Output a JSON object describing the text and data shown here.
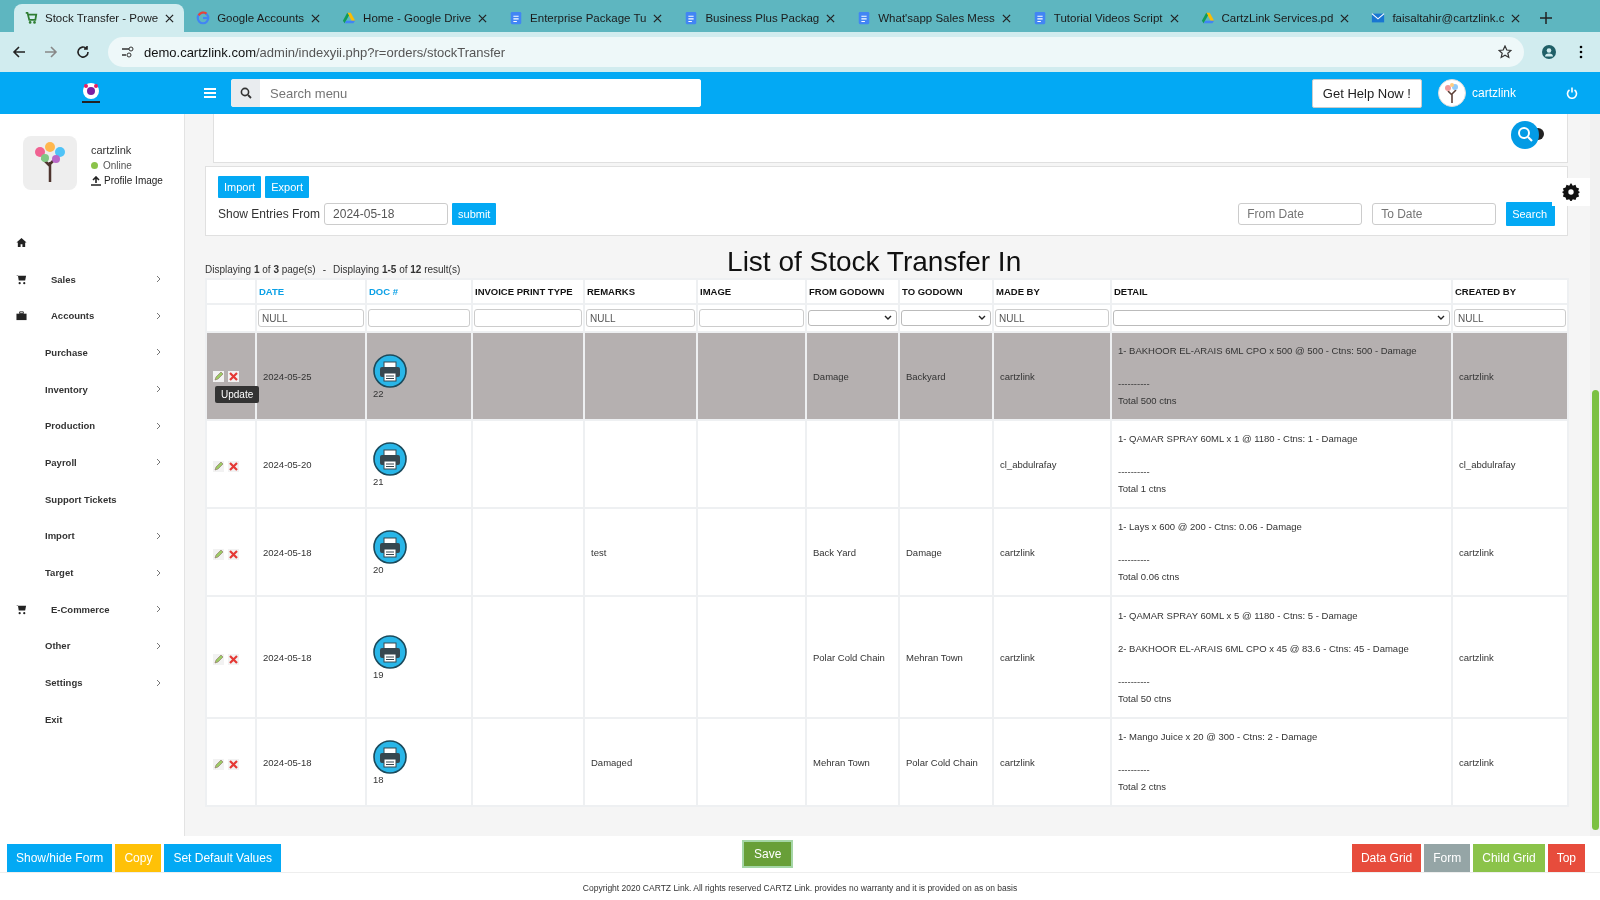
{
  "browser": {
    "tabs": [
      {
        "title": "Stock Transfer - Powe",
        "kind": "cart",
        "selected": true
      },
      {
        "title": "Google Accounts",
        "kind": "google",
        "selected": false
      },
      {
        "title": "Home - Google Drive",
        "kind": "drive",
        "selected": false
      },
      {
        "title": "Enterprise Package Tu",
        "kind": "doc",
        "selected": false
      },
      {
        "title": "Business Plus Packag",
        "kind": "doc",
        "selected": false
      },
      {
        "title": "What'sapp Sales Mess",
        "kind": "doc",
        "selected": false
      },
      {
        "title": "Tutorial Videos Script",
        "kind": "doc",
        "selected": false
      },
      {
        "title": "CartzLink Services.pd",
        "kind": "drive",
        "selected": false
      },
      {
        "title": "faisaltahir@cartzlink.c",
        "kind": "mail",
        "selected": false
      }
    ],
    "url_host": "demo.cartzlink.com",
    "url_path": "/admin/indexyii.php?r=orders/stockTransfer"
  },
  "header": {
    "search_placeholder": "Search menu",
    "help_button": "Get Help Now !",
    "user": "cartzlink"
  },
  "sidebar": {
    "user": {
      "name": "cartzlink",
      "status": "Online",
      "profile_link": "Profile Image"
    },
    "items": [
      {
        "kind": "home",
        "arrow": false
      },
      {
        "label": "Sales",
        "kind": "cart",
        "arrow": true
      },
      {
        "label": "Accounts",
        "kind": "briefcase",
        "arrow": true
      },
      {
        "label": "Purchase",
        "kind": "plain",
        "arrow": true
      },
      {
        "label": "Inventory",
        "kind": "plain",
        "arrow": true
      },
      {
        "label": "Production",
        "kind": "plain",
        "arrow": true
      },
      {
        "label": "Payroll",
        "kind": "plain",
        "arrow": true
      },
      {
        "label": "Support Tickets",
        "kind": "plain",
        "arrow": false
      },
      {
        "label": "Import",
        "kind": "plain",
        "arrow": true
      },
      {
        "label": "Target",
        "kind": "plain",
        "arrow": true
      },
      {
        "label": "E-Commerce",
        "kind": "cart",
        "arrow": true
      },
      {
        "label": "Other",
        "kind": "plain",
        "arrow": true
      },
      {
        "label": "Settings",
        "kind": "plain",
        "arrow": true
      },
      {
        "label": "Exit",
        "kind": "plain",
        "arrow": false
      }
    ]
  },
  "toolbar": {
    "import": "Import",
    "export": "Export",
    "show_entries_label": "Show Entries From",
    "entries_date": "2024-05-18",
    "submit": "submit",
    "from_date_placeholder": "From Date",
    "to_date_placeholder": "To Date",
    "search": "Search"
  },
  "title": "List of Stock Transfer In",
  "pagination": [
    "Displaying **1** of **3** page(s)",
    "-",
    "Displaying **1-5** of **12** result(s)"
  ],
  "table": {
    "columns": [
      {
        "label": "DATE",
        "sortable": true
      },
      {
        "label": "DOC #",
        "sortable": true
      },
      {
        "label": "INVOICE PRINT TYPE",
        "sortable": false
      },
      {
        "label": "REMARKS",
        "sortable": false
      },
      {
        "label": "IMAGE",
        "sortable": false
      },
      {
        "label": "FROM GODOWN",
        "sortable": false
      },
      {
        "label": "TO GODOWN",
        "sortable": false
      },
      {
        "label": "MADE BY",
        "sortable": false
      },
      {
        "label": "DETAIL",
        "sortable": false
      },
      {
        "label": "CREATED BY",
        "sortable": false
      }
    ],
    "filters": [
      {
        "kind": "text",
        "value": "NULL"
      },
      {
        "kind": "text"
      },
      {
        "kind": "text"
      },
      {
        "kind": "text",
        "value": "NULL"
      },
      {
        "kind": "text"
      },
      {
        "kind": "select"
      },
      {
        "kind": "select"
      },
      {
        "kind": "text",
        "value": "NULL"
      },
      {
        "kind": "select"
      },
      {
        "kind": "text",
        "value": "NULL"
      }
    ],
    "tooltip": "Update",
    "rows": [
      {
        "selected": true,
        "date": "2024-05-25",
        "doc": "22",
        "remarks": "",
        "from": "Damage",
        "to": "Backyard",
        "made_by": "cartzlink",
        "detail": [
          "1- BAKHOOR EL-ARAIS 6ML CPO x 500 @ 500 - Ctns: 500 - Damage"
        ],
        "separator": "----------",
        "total": "Total 500 ctns",
        "created_by": "cartzlink"
      },
      {
        "selected": false,
        "date": "2024-05-20",
        "doc": "21",
        "remarks": "",
        "from": "",
        "to": "",
        "made_by": "cl_abdulrafay",
        "detail": [
          "1- QAMAR SPRAY 60ML x 1 @ 1180 - Ctns: 1 - Damage"
        ],
        "separator": "----------",
        "total": "Total 1 ctns",
        "created_by": "cl_abdulrafay"
      },
      {
        "selected": false,
        "date": "2024-05-18",
        "doc": "20",
        "remarks": "test",
        "from": "Back Yard",
        "to": "Damage",
        "made_by": "cartzlink",
        "detail": [
          "1- Lays x 600 @ 200 - Ctns: 0.06 - Damage"
        ],
        "separator": "----------",
        "total": "Total 0.06 ctns",
        "created_by": "cartzlink"
      },
      {
        "selected": false,
        "date": "2024-05-18",
        "doc": "19",
        "remarks": "",
        "from": "Polar Cold Chain",
        "to": "Mehran Town",
        "made_by": "cartzlink",
        "detail": [
          "1- QAMAR SPRAY 60ML x 5 @ 1180 - Ctns: 5 - Damage",
          "2- BAKHOOR EL-ARAIS 6ML CPO x 45 @ 83.6 - Ctns: 45 - Damage"
        ],
        "separator": "----------",
        "total": "Total 50 ctns",
        "created_by": "cartzlink"
      },
      {
        "selected": false,
        "date": "2024-05-18",
        "doc": "18",
        "remarks": "Damaged",
        "from": "Mehran Town",
        "to": "Polar Cold Chain",
        "made_by": "cartzlink",
        "detail": [
          "1- Mango Juice x 20 @ 300 - Ctns: 2 - Damage"
        ],
        "separator": "----------",
        "total": "Total 2 ctns",
        "created_by": "cartzlink"
      }
    ]
  },
  "bottom_left": [
    {
      "label": "Show/hide Form",
      "color": "#03a9f4"
    },
    {
      "label": "Copy",
      "color": "#ffc107"
    },
    {
      "label": "Set Default Values",
      "color": "#03a9f4"
    }
  ],
  "save": "Save",
  "bottom_right": [
    {
      "label": "Data Grid",
      "color": "#e74c3c"
    },
    {
      "label": "Form",
      "color": "#95a5a6"
    },
    {
      "label": "Child Grid",
      "color": "#8bc34a"
    },
    {
      "label": "Top",
      "color": "#e74c3c"
    }
  ],
  "copyright": "Copyright 2020 CARTZ Link. All rights reserved CARTZ Link. provides no warranty and it is provided on as on basis"
}
